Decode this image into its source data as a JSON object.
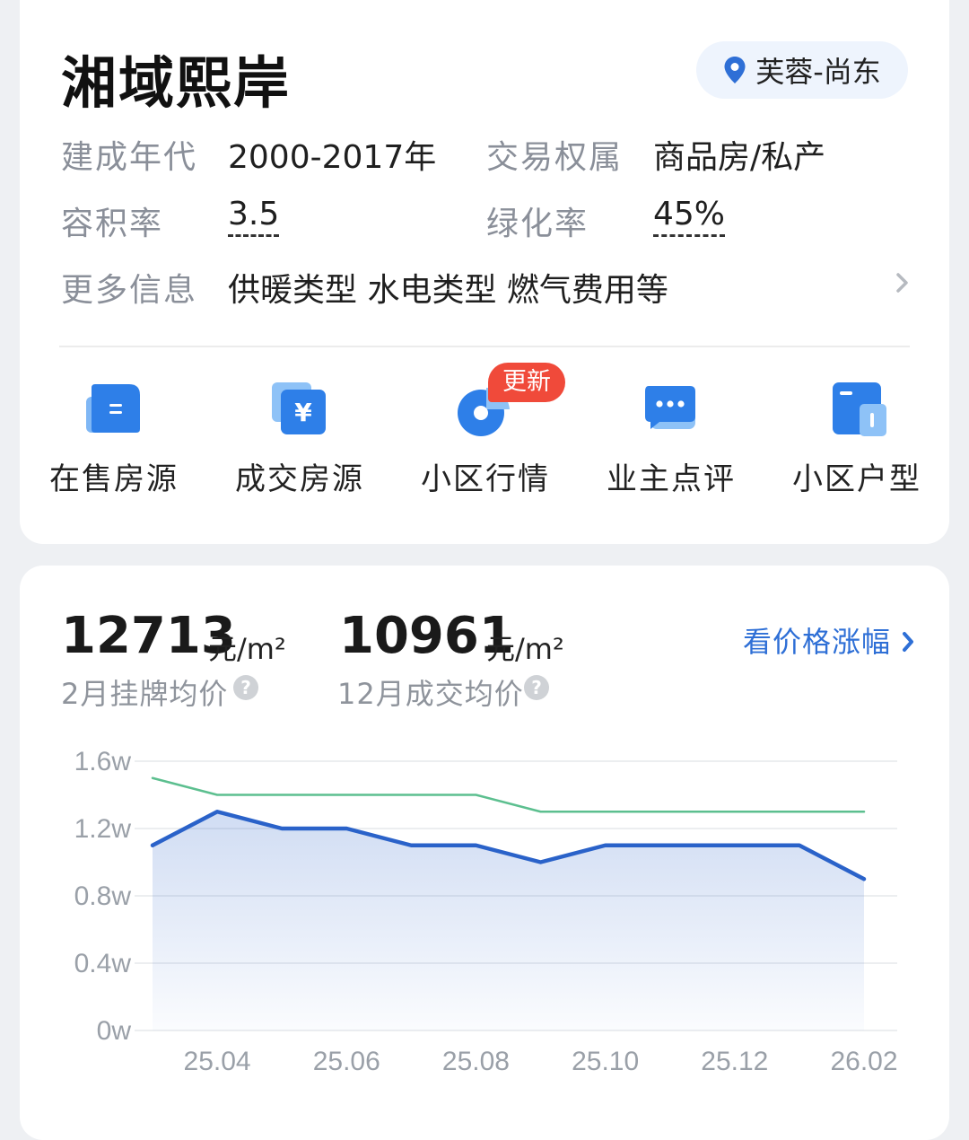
{
  "community": {
    "name": "湘域熙岸",
    "location": "芙蓉-尚东",
    "location_icon": "map-pin-icon"
  },
  "info": {
    "rows": [
      {
        "label1": "建成年代",
        "value1": "2000-2017年",
        "label2": "交易权属",
        "value2": "商品房/私产"
      },
      {
        "label1": "容积率",
        "value1": "3.5",
        "label2": "绿化率",
        "value2": "45%"
      }
    ],
    "more_label": "更多信息",
    "more_value": "供暖类型 水电类型 燃气费用等"
  },
  "shortcuts": [
    {
      "label": "在售房源",
      "icon": "listing-icon"
    },
    {
      "label": "成交房源",
      "icon": "yuan-icon"
    },
    {
      "label": "小区行情",
      "icon": "pie-chart-icon",
      "badge": "更新"
    },
    {
      "label": "业主点评",
      "icon": "chat-icon"
    },
    {
      "label": "小区户型",
      "icon": "floorplan-icon"
    }
  ],
  "prices": {
    "listing_price": "12713",
    "listing_unit": "元/m²",
    "listing_label": "2月挂牌均价",
    "deal_price": "10961",
    "deal_unit": "元/m²",
    "deal_label": "12月成交均价",
    "link_label": "看价格涨幅"
  },
  "colors": {
    "accent_blue": "#2e6fd6",
    "line_blue": "#2a62c9",
    "line_green": "#5cbf8f",
    "badge_red": "#f04a3a"
  },
  "chart_data": {
    "type": "line",
    "x": [
      "25.03",
      "25.04",
      "25.05",
      "25.06",
      "25.07",
      "25.08",
      "25.09",
      "25.10",
      "25.11",
      "25.12",
      "26.01",
      "26.02"
    ],
    "xtick_labels": [
      "25.04",
      "25.06",
      "25.08",
      "25.10",
      "25.12",
      "26.02"
    ],
    "ytick_labels": [
      "1.6w",
      "1.2w",
      "0.8w",
      "0.4w",
      "0w"
    ],
    "ylim": [
      0,
      16000
    ],
    "series": [
      {
        "values": [
          15000,
          14000,
          14000,
          14000,
          14000,
          14000,
          13000,
          13000,
          13000,
          13000,
          13000,
          13000
        ],
        "color": "#5cbf8f"
      },
      {
        "values": [
          11000,
          13000,
          12000,
          12000,
          11000,
          11000,
          10000,
          11000,
          11000,
          11000,
          11000,
          9000
        ],
        "color": "#2a62c9",
        "area": true
      }
    ]
  }
}
